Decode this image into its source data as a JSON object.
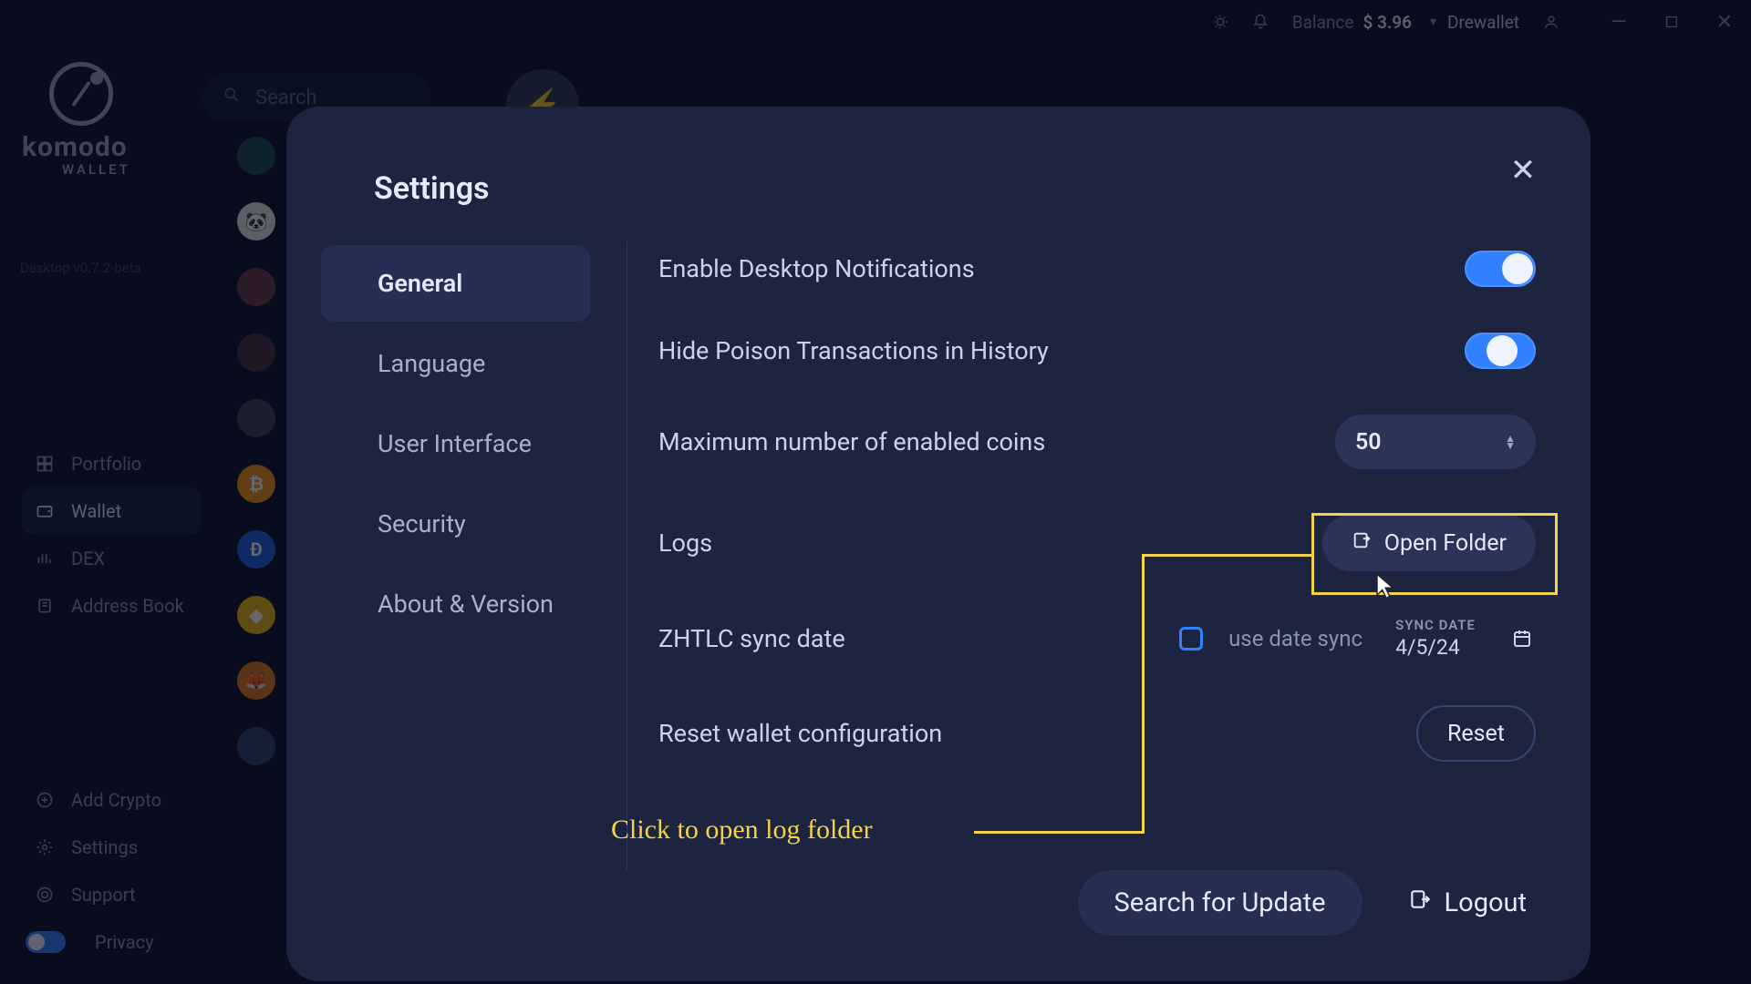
{
  "titlebar": {
    "balance_label": "Balance",
    "balance_amount": "$ 3.96",
    "wallet_name": "Drewallet"
  },
  "brand": {
    "name": "komodo",
    "sub": "WALLET",
    "version": "Desktop v0.7.2-beta"
  },
  "search": {
    "placeholder": "Search"
  },
  "nav": {
    "portfolio": "Portfolio",
    "wallet": "Wallet",
    "dex": "DEX",
    "address_book": "Address Book",
    "add_crypto": "Add Crypto",
    "settings": "Settings",
    "support": "Support",
    "privacy": "Privacy"
  },
  "modal": {
    "title": "Settings",
    "tabs": {
      "general": "General",
      "language": "Language",
      "ui": "User Interface",
      "security": "Security",
      "about": "About & Version"
    },
    "rows": {
      "notifications": "Enable Desktop Notifications",
      "poison": "Hide Poison Transactions in History",
      "max_coins": "Maximum number of enabled coins",
      "max_coins_value": "50",
      "logs": "Logs",
      "open_folder": "Open Folder",
      "zhtlc": "ZHTLC sync date",
      "use_date_sync": "use date sync",
      "sync_date_label": "SYNC DATE",
      "sync_date_value": "4/5/24",
      "reset_label": "Reset wallet configuration",
      "reset_btn": "Reset"
    },
    "footer": {
      "search_update": "Search for Update",
      "logout": "Logout"
    }
  },
  "annotation": {
    "text": "Click to open log folder"
  }
}
